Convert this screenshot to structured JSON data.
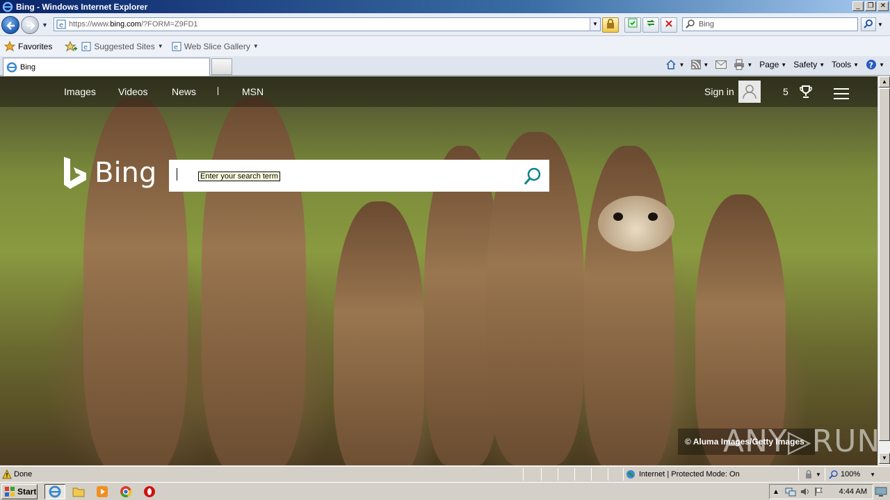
{
  "window": {
    "title": "Bing - Windows Internet Explorer",
    "controls": [
      "_",
      "❐",
      "✕"
    ]
  },
  "address_bar": {
    "url_prefix": "https://www.",
    "url_domain": "bing.com",
    "url_rest": "/?FORM=Z9FD1"
  },
  "search_provider": {
    "placeholder": "Bing"
  },
  "favorites_bar": {
    "favorites_label": "Favorites",
    "suggested_sites_label": "Suggested Sites",
    "web_slice_label": "Web Slice Gallery"
  },
  "tabs": [
    {
      "label": "Bing"
    }
  ],
  "command_bar": {
    "page_label": "Page",
    "safety_label": "Safety",
    "tools_label": "Tools"
  },
  "bing": {
    "nav": {
      "images": "Images",
      "videos": "Videos",
      "news": "News",
      "msn": "MSN"
    },
    "sign_in": "Sign in",
    "rewards_count": "5",
    "logo_text": "Bing",
    "search_tooltip": "Enter your search term",
    "copyright": "© Aluma Images/Getty Images",
    "watermark": "ANY▷RUN"
  },
  "status_bar": {
    "status": "Done",
    "zone": "Internet | Protected Mode: On",
    "zoom": "100%"
  },
  "taskbar": {
    "start_label": "Start",
    "clock": "4:44 AM"
  },
  "colors": {
    "accent": "#0a246a",
    "bing_teal": "#0c8484"
  }
}
